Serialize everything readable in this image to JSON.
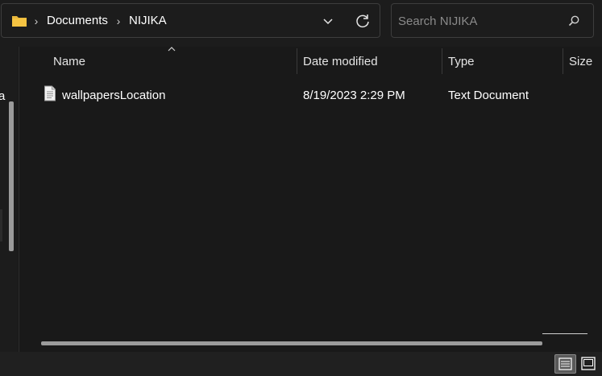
{
  "breadcrumb": {
    "items": [
      "Documents",
      "NIJIKA"
    ],
    "separator": "›"
  },
  "search": {
    "placeholder": "Search NIJIKA"
  },
  "nav_pane": {
    "partial_label": "a"
  },
  "file_list": {
    "columns": [
      "Name",
      "Date modified",
      "Type",
      "Size"
    ],
    "sort_column": "Name",
    "rows": [
      {
        "name": "wallpapersLocation",
        "date_modified": "8/19/2023 2:29 PM",
        "type": "Text Document",
        "size": "",
        "icon": "text-document-icon"
      }
    ]
  },
  "view_modes": [
    "details",
    "large-icons"
  ],
  "active_view": "details",
  "colors": {
    "background": "#191919",
    "toolbar": "#1c1c1c",
    "border": "#3d3d3d",
    "text": "#ffffff",
    "muted_text": "#8a8a8a",
    "folder_yellow": "#f5c342",
    "scrollbar": "#9b9b9b"
  }
}
